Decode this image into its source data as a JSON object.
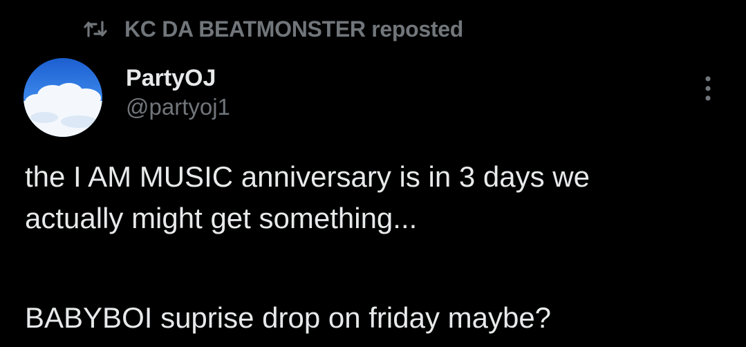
{
  "repost": {
    "icon": "repost-icon",
    "text": "KC DA BEATMONSTER reposted"
  },
  "author": {
    "avatar_icon": "sky-clouds-avatar",
    "display_name": "PartyOJ",
    "handle": "@partyoj1"
  },
  "menu": {
    "icon": "more-vertical-icon"
  },
  "tweet": {
    "line1": "the I AM MUSIC anniversary is in 3 days we",
    "line2": "actually might get something...",
    "line3": "BABYBOI suprise drop on friday maybe?"
  },
  "colors": {
    "background": "#000000",
    "primary_text": "#e7e9ea",
    "secondary_text": "#71767b",
    "avatar_sky": "#1f66d6"
  }
}
